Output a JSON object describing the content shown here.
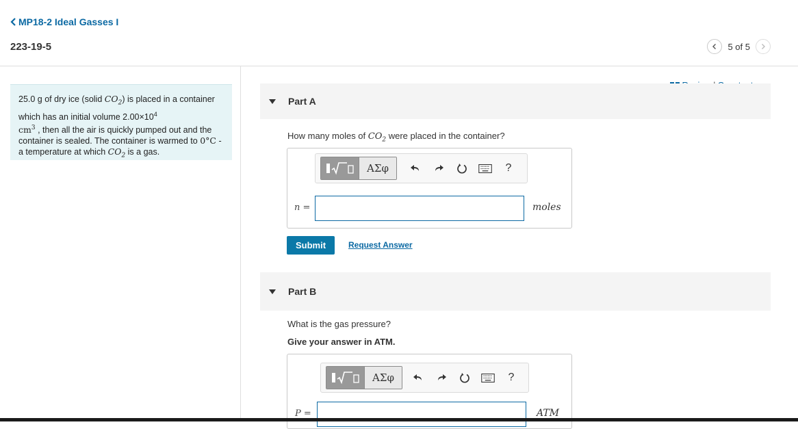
{
  "nav": {
    "back_label": "MP18-2 Ideal Gasses I",
    "problem_id": "223-19-5",
    "pager_count": "5 of 5"
  },
  "intro": {
    "t1": "25.0  g of dry ice (solid ",
    "co2_c": "CO",
    "co2_sub": "2",
    "t2": ") is placed in a container which has an initial volume 2.00×10",
    "exp4": "4",
    "cm": "cm",
    "cm_exp": "3",
    "t3": " , then all the air is quickly pumped out and the container is sealed. The container is warmed to ",
    "zero": "0°",
    "c_unit": "C",
    "t4": " - a temperature at which ",
    "co2b_c": "CO",
    "co2b_sub": "2",
    "t5": " is a gas."
  },
  "links": {
    "review": "Review",
    "sep": "|",
    "constants": "Constants"
  },
  "toolbar": {
    "greek_label": "ΑΣφ",
    "help_label": "?"
  },
  "partA": {
    "label": "Part A",
    "q_pre": "How many moles of ",
    "q_co": "CO",
    "q_sub": "2",
    "q_post": " were placed in the container?",
    "var_label": "n =",
    "unit": "moles",
    "input_value": ""
  },
  "actions": {
    "submit_label": "Submit",
    "request_label": "Request Answer"
  },
  "partB": {
    "label": "Part B",
    "question": "What is the gas pressure?",
    "instruction": "Give your answer in ATM.",
    "var_label": "P =",
    "unit": "ATM",
    "input_value": ""
  },
  "colors": {
    "accent": "#0b69a3",
    "submit_bg": "#0b79a8",
    "intro_bg": "#e6f4f6"
  }
}
